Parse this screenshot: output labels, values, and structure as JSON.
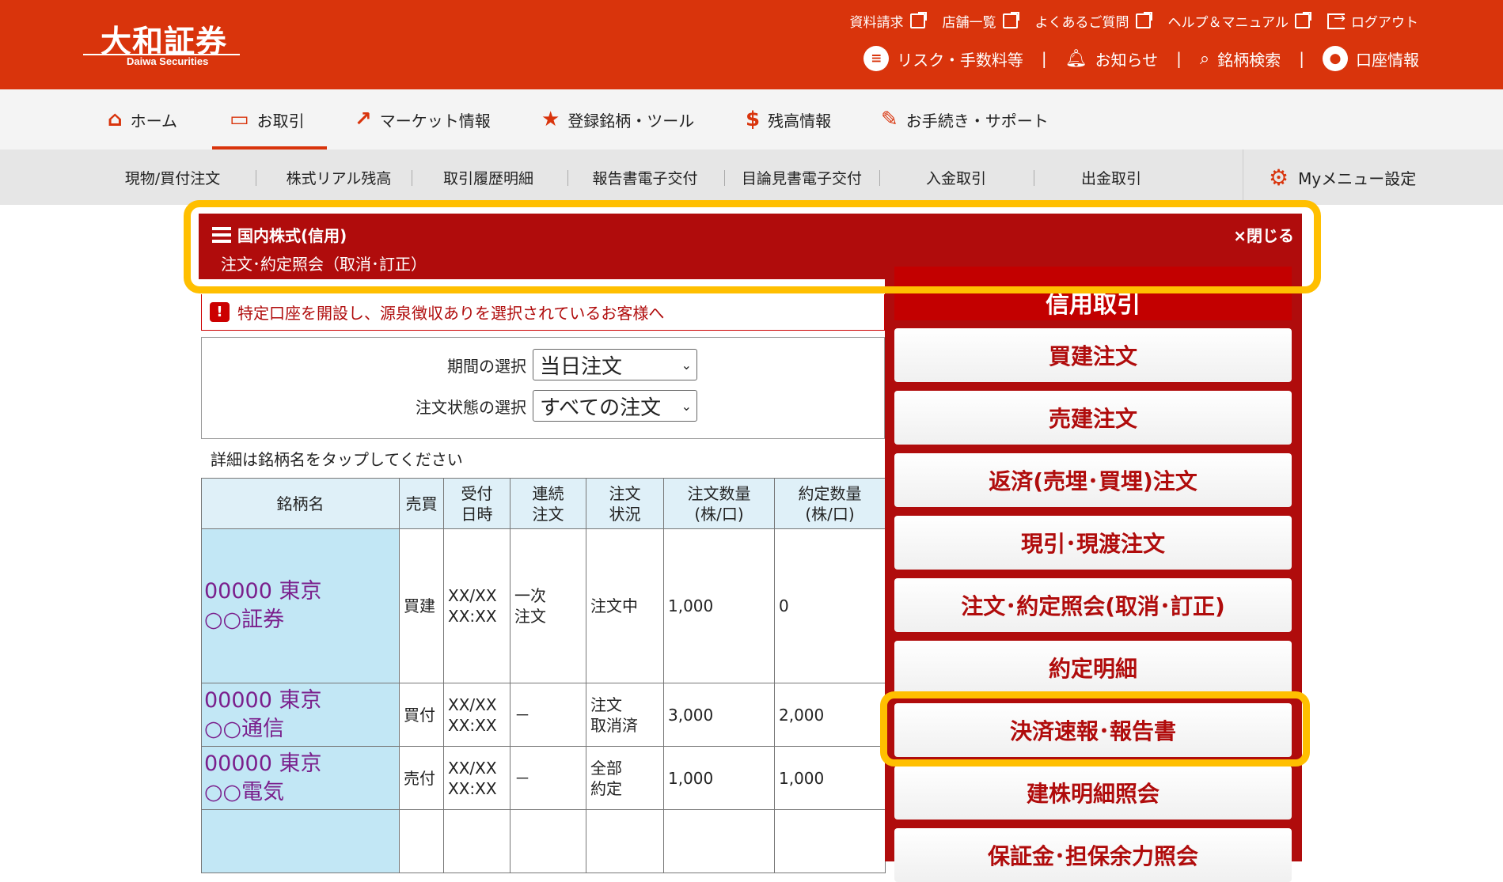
{
  "brand": {
    "logo_jp": "大和証券",
    "logo_en": "Daiwa Securities"
  },
  "header": {
    "top_links": [
      {
        "label": "資料請求",
        "icon": "external-link-icon"
      },
      {
        "label": "店舗一覧",
        "icon": "external-link-icon"
      },
      {
        "label": "よくあるご質問",
        "icon": "external-link-icon"
      },
      {
        "label": "ヘルプ＆マニュアル",
        "icon": "external-link-icon"
      },
      {
        "label": "ログアウト",
        "icon": "logout-icon"
      }
    ],
    "second_links": [
      {
        "label": "リスク・手数料等",
        "icon": "document-icon"
      },
      {
        "label": "お知らせ",
        "icon": "bell-icon"
      },
      {
        "label": "銘柄検索",
        "icon": "search-icon"
      },
      {
        "label": "口座情報",
        "icon": "user-icon"
      }
    ]
  },
  "nav": {
    "items": [
      {
        "label": "ホーム",
        "icon": "home-icon"
      },
      {
        "label": "お取引",
        "icon": "monitor-icon"
      },
      {
        "label": "マーケット情報",
        "icon": "chart-icon"
      },
      {
        "label": "登録銘柄・ツール",
        "icon": "star-icon"
      },
      {
        "label": "残高情報",
        "icon": "dollar-icon"
      },
      {
        "label": "お手続き・サポート",
        "icon": "pencil-icon"
      }
    ],
    "active": "お取引"
  },
  "subnav": {
    "items": [
      "現物/買付注文",
      "株式リアル残高",
      "取引履歴明細",
      "報告書電子交付",
      "目論見書電子交付",
      "入金取引",
      "出金取引"
    ],
    "my_menu": "Myメニュー設定"
  },
  "title_bar": {
    "category": "国内株式(信用)",
    "page": "注文･約定照会（取消･訂正）",
    "close": "×閉じる"
  },
  "notice": {
    "text": "特定口座を開設し、源泉徴収ありを選択されているお客様へ"
  },
  "filters": {
    "period_label": "期間の選択",
    "period_value": "当日注文",
    "status_label": "注文状態の選択",
    "status_value": "すべての注文"
  },
  "hint": "詳細は銘柄名をタップしてください",
  "table": {
    "headers": [
      "銘柄名",
      "売買",
      "受付日時",
      "連続注文",
      "注文状況",
      "注文数量(株/口)",
      "約定数量(株/口)"
    ],
    "header_lines": [
      [
        "銘柄名"
      ],
      [
        "売買"
      ],
      [
        "受付",
        "日時"
      ],
      [
        "連続",
        "注文"
      ],
      [
        "注文",
        "状況"
      ],
      [
        "注文数量",
        "(株/口)"
      ],
      [
        "約定数量",
        "(株/口)"
      ]
    ],
    "rows": [
      {
        "name_line1": "00000 東京",
        "name_line2": "○○証券",
        "side": "買建",
        "time_line1": "XX/XX",
        "time_line2": "XX:XX",
        "chain_line1": "一次",
        "chain_line2": "注文",
        "status_line1": "注文中",
        "status_line2": "",
        "order_qty": "1,000",
        "exec_qty": "0"
      },
      {
        "name_line1": "00000 東京",
        "name_line2": "○○通信",
        "side": "買付",
        "time_line1": "XX/XX",
        "time_line2": "XX:XX",
        "chain_line1": "－",
        "chain_line2": "",
        "status_line1": "注文",
        "status_line2": "取消済",
        "order_qty": "3,000",
        "exec_qty": "2,000"
      },
      {
        "name_line1": "00000 東京",
        "name_line2": "○○電気",
        "side": "売付",
        "time_line1": "XX/XX",
        "time_line2": "XX:XX",
        "chain_line1": "－",
        "chain_line2": "",
        "status_line1": "全部",
        "status_line2": "約定",
        "order_qty": "1,000",
        "exec_qty": "1,000"
      }
    ]
  },
  "side_menu": {
    "header": "信用取引",
    "buttons": [
      "買建注文",
      "売建注文",
      "返済(売埋･買埋)注文",
      "現引･現渡注文",
      "注文･約定照会(取消･訂正)",
      "約定明細",
      "決済速報･報告書",
      "建株明細照会",
      "保証金･担保余力照会"
    ]
  },
  "colors": {
    "brand_red": "#d9340c",
    "dark_red": "#b00c0c",
    "highlight": "#ffbf00",
    "link_purple": "#7a1f8c",
    "cell_blue": "#c2e7f5"
  }
}
